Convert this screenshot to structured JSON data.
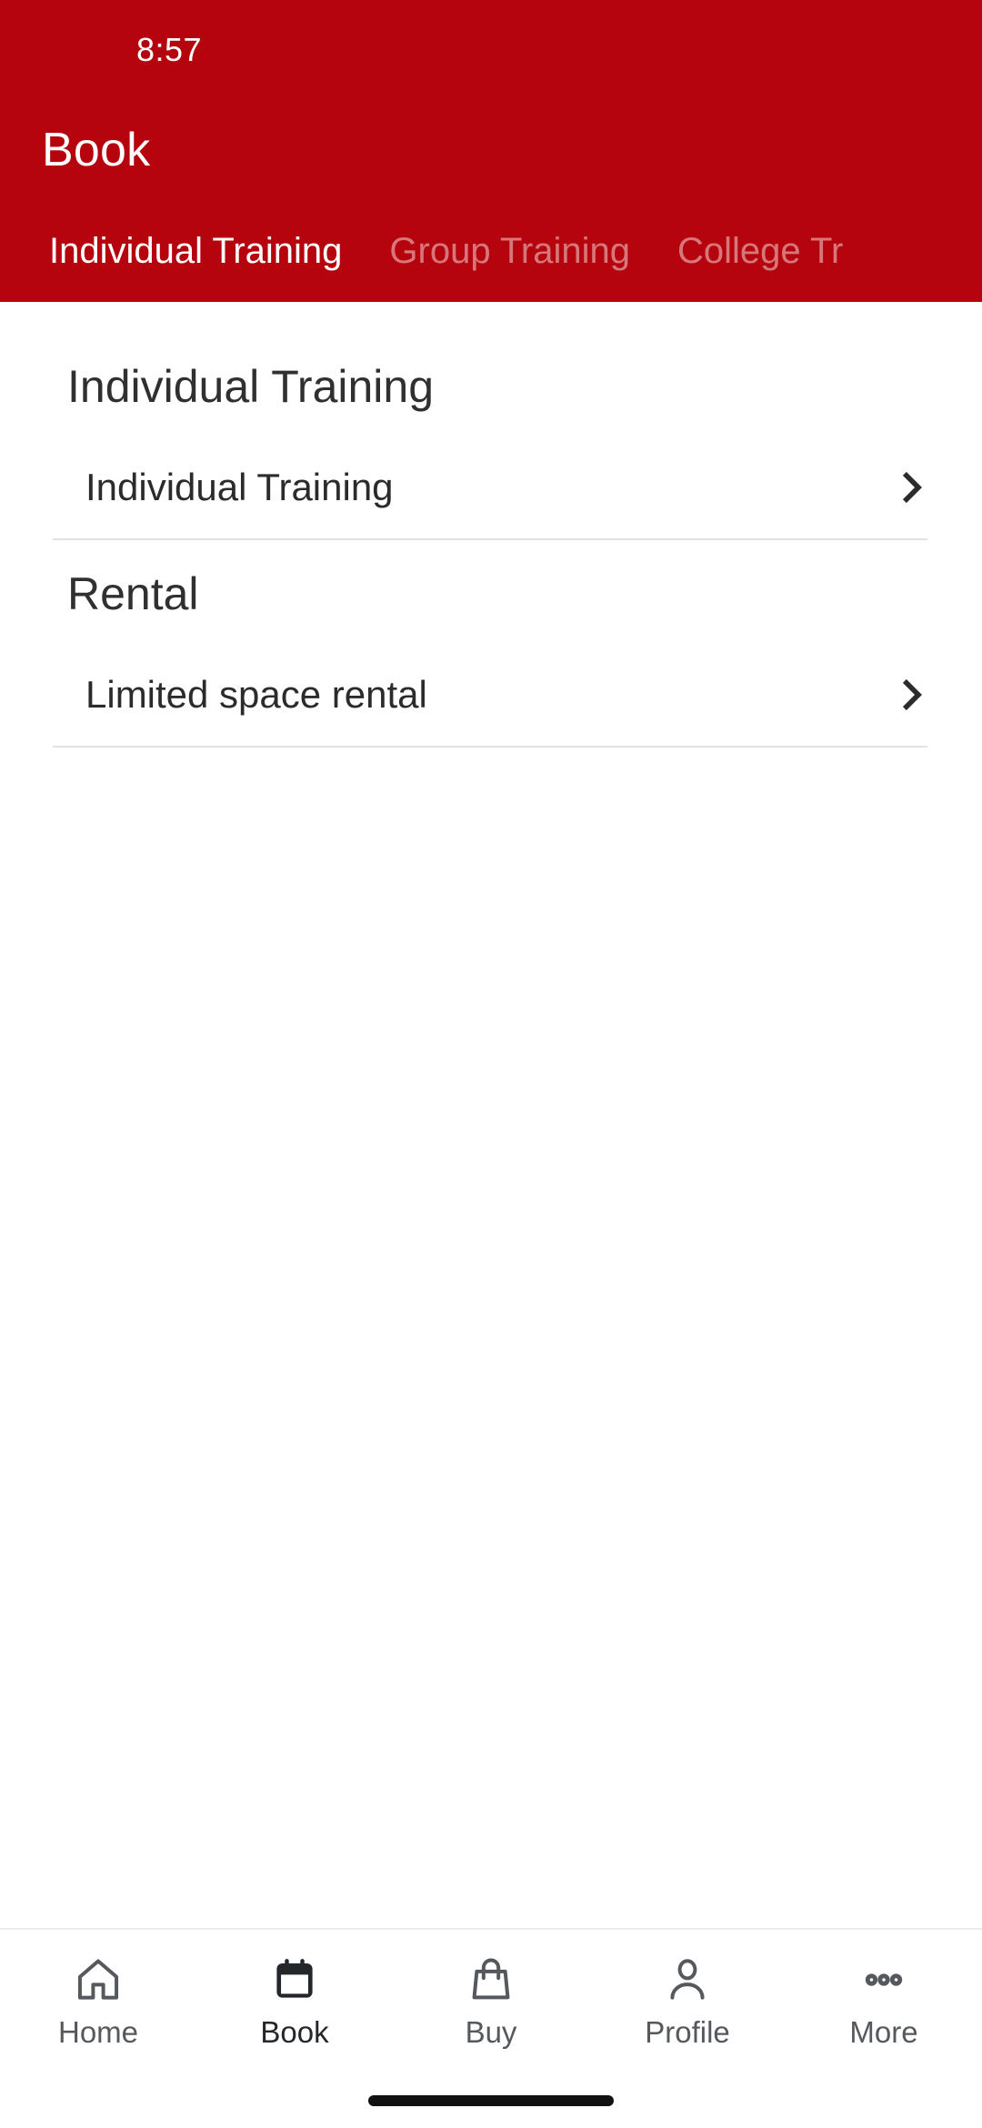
{
  "status_bar": {
    "time": "8:57"
  },
  "header": {
    "title": "Book",
    "background_color": "#b5040d",
    "tabs": [
      {
        "label": "Individual Training",
        "active": true
      },
      {
        "label": "Group Training",
        "active": false
      },
      {
        "label": "College Tr",
        "active": false
      }
    ]
  },
  "content": {
    "sections": [
      {
        "heading": "Individual Training",
        "items": [
          {
            "label": "Individual Training",
            "chevron": "chevron-right-icon"
          }
        ]
      },
      {
        "heading": "Rental",
        "items": [
          {
            "label": "Limited space rental",
            "chevron": "chevron-right-icon"
          }
        ]
      }
    ]
  },
  "bottom_nav": {
    "items": [
      {
        "label": "Home",
        "icon": "home-icon",
        "active": false
      },
      {
        "label": "Book",
        "icon": "calendar-icon",
        "active": true
      },
      {
        "label": "Buy",
        "icon": "shopping-bag-icon",
        "active": false
      },
      {
        "label": "Profile",
        "icon": "person-icon",
        "active": false
      },
      {
        "label": "More",
        "icon": "ellipsis-icon",
        "active": false
      }
    ]
  }
}
